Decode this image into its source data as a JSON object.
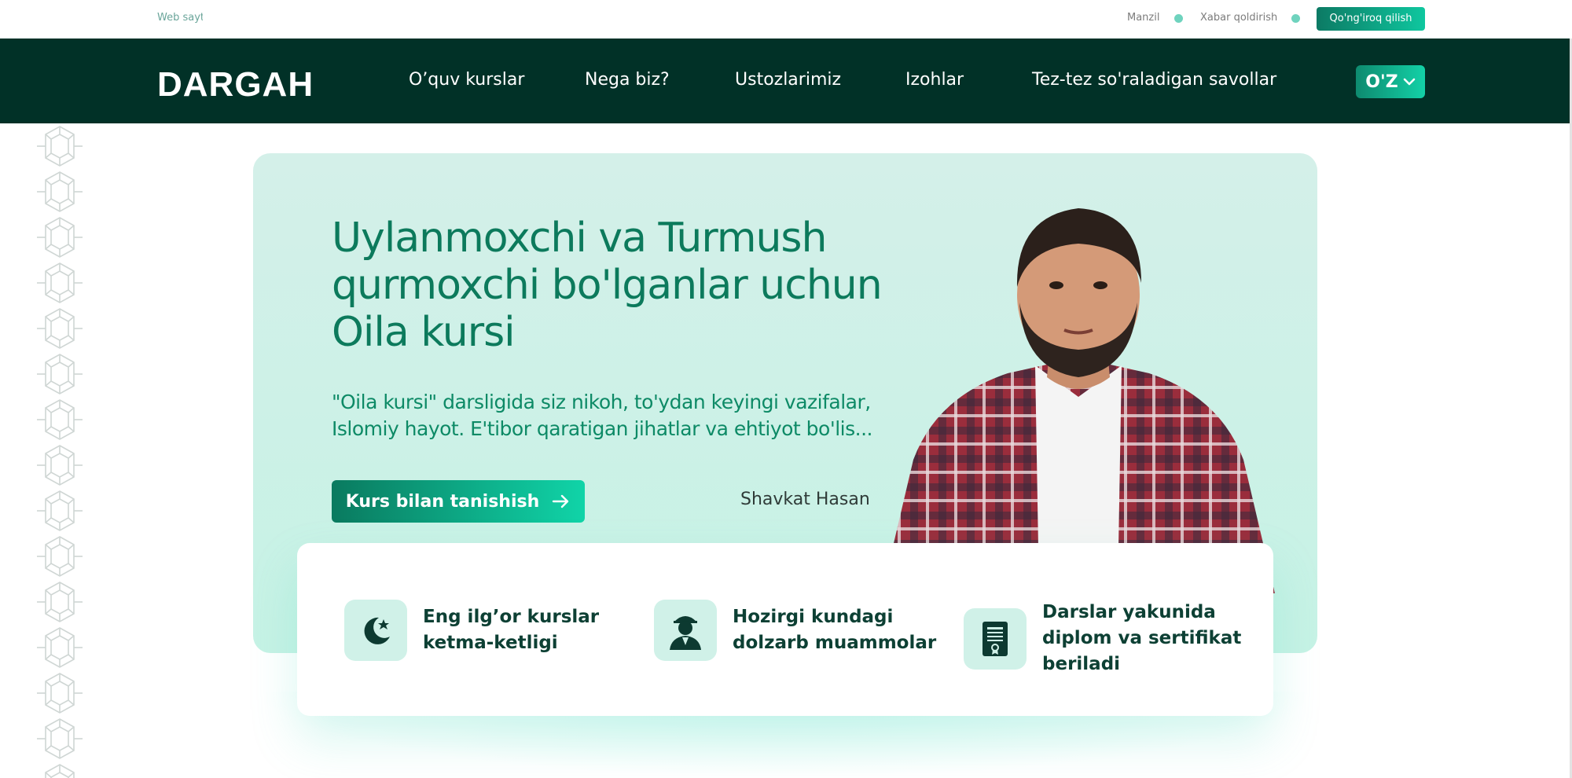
{
  "topbar": {
    "website_text": "Web sayt",
    "address": "Manzil",
    "leave_message": "Xabar qoldirish",
    "call_button": "Qo'ng'iroq qilish"
  },
  "nav": {
    "logo": "DARGAH",
    "items": [
      "O’quv kurslar",
      "Nega biz?",
      "Ustozlarimiz",
      "Izohlar",
      "Tez-tez so'raladigan savollar"
    ],
    "language": "O'Z"
  },
  "hero": {
    "title": "Uylanmoxchi va Turmush qurmoxchi bo'lganlar uchun Oila kursi",
    "description": "\"Oila kursi\" darsligida siz nikoh, to'ydan keyingi vazifalar, Islomiy hayot. E'tibor qaratigan jihatlar va ehtiyot bo'lis...",
    "cta_label": "Kurs bilan tanishish",
    "author_name": "Shavkat Hasan"
  },
  "features": [
    {
      "text": "Eng ilg’or kurslar ketma-ketligi",
      "icon": "moon-star-icon"
    },
    {
      "text": "Hozirgi kundagi dolzarb muammolar",
      "icon": "person-icon"
    },
    {
      "text": "Darslar yakunida diplom va sertifikat beriladi",
      "icon": "certificate-icon"
    }
  ],
  "colors": {
    "nav_bg": "#013127",
    "accent": "#0fc79f",
    "hero_bg": "#d4f0e9",
    "title_green": "#0c7a5c",
    "feature_text": "#0d4034"
  }
}
